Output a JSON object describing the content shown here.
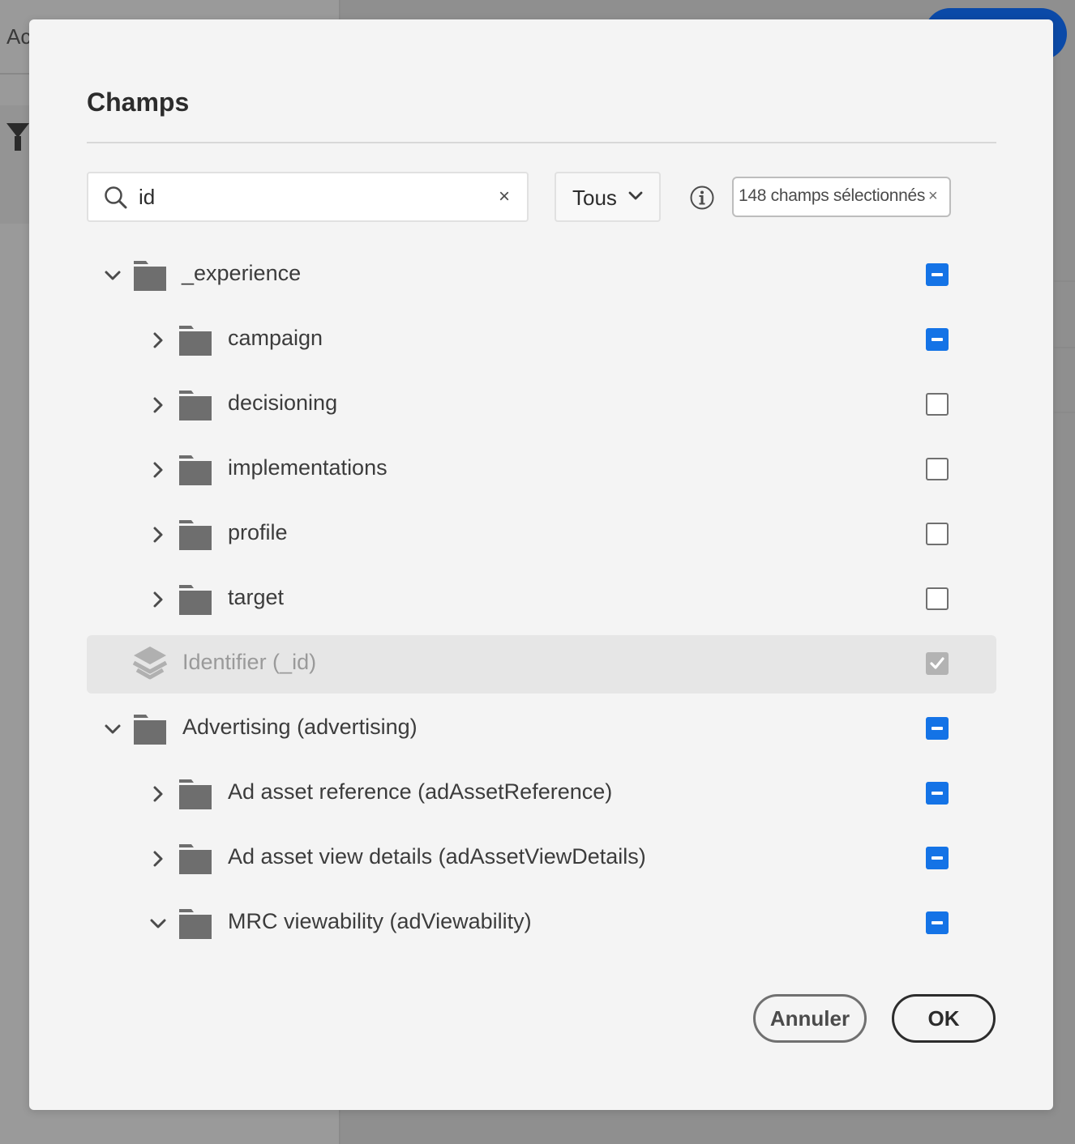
{
  "background": {
    "left_title": "Ac"
  },
  "dialog": {
    "title": "Champs",
    "search": {
      "value": "id",
      "clear_label": "×"
    },
    "filter": {
      "selected": "Tous"
    },
    "selection_tag": {
      "label": "148 champs sélectionnés",
      "remove_label": "×"
    },
    "tree": [
      {
        "label": "_experience",
        "state": "indeterminate",
        "expanded": true
      },
      {
        "label": "campaign",
        "state": "indeterminate",
        "expanded": false
      },
      {
        "label": "decisioning",
        "state": "unchecked",
        "expanded": false
      },
      {
        "label": "implementations",
        "state": "unchecked",
        "expanded": false
      },
      {
        "label": "profile",
        "state": "unchecked",
        "expanded": false
      },
      {
        "label": "target",
        "state": "unchecked",
        "expanded": false
      },
      {
        "label": "Identifier (_id)",
        "state": "checked-disabled"
      },
      {
        "label": "Advertising (advertising)",
        "state": "indeterminate",
        "expanded": true
      },
      {
        "label": "Ad asset reference (adAssetReference)",
        "state": "indeterminate",
        "expanded": false
      },
      {
        "label": "Ad asset view details (adAssetViewDetails)",
        "state": "indeterminate",
        "expanded": false
      },
      {
        "label": "MRC viewability (adViewability)",
        "state": "indeterminate",
        "expanded": true
      }
    ],
    "buttons": {
      "cancel": "Annuler",
      "ok": "OK"
    }
  },
  "colors": {
    "accent": "#1473e6",
    "dialog_bg": "#f4f4f4",
    "overlay_bg": "#8f8f8f"
  },
  "icons": {
    "search": "search-icon",
    "chevron_down": "chevron-down-icon",
    "chevron_right": "chevron-right-icon",
    "folder": "folder-icon",
    "info": "info-icon",
    "layers": "layers-icon",
    "close": "close-icon"
  }
}
